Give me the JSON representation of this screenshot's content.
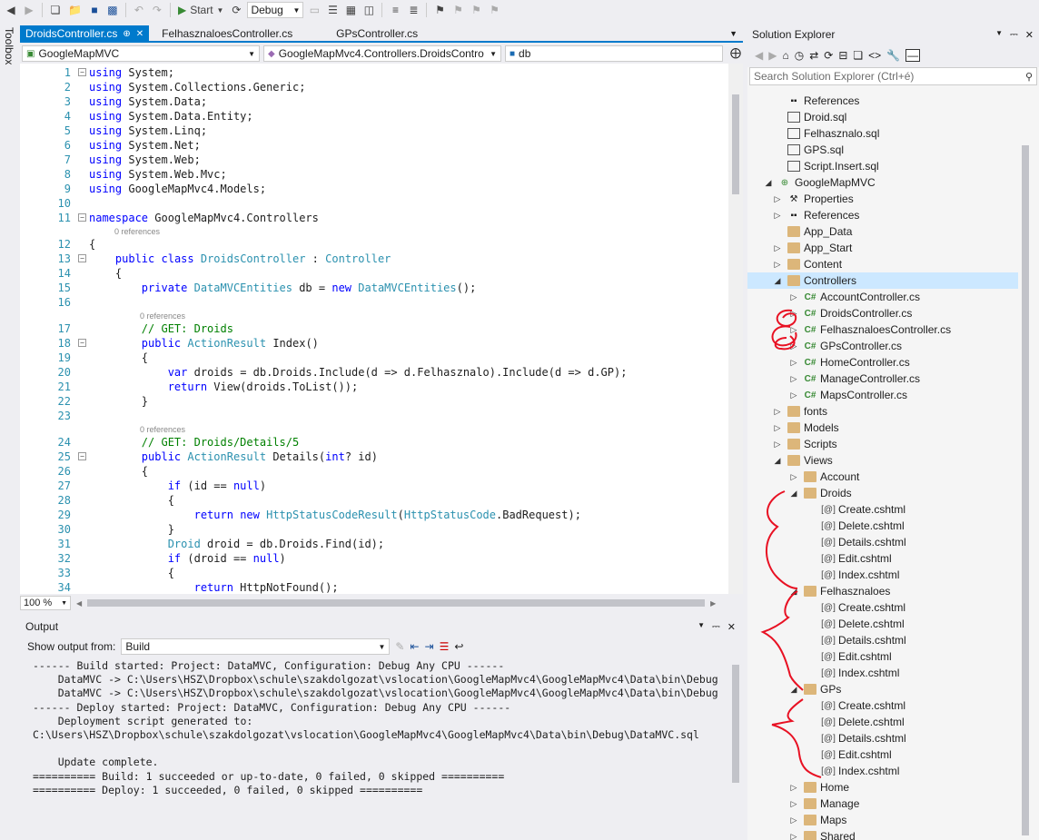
{
  "toolbar": {
    "start_label": "Start",
    "config_value": "Debug"
  },
  "toolbox": {
    "label": "Toolbox"
  },
  "tabs": [
    {
      "label": "DroidsController.cs",
      "pin": "⊕",
      "close": "✕"
    },
    {
      "label": "FelhasznaloesController.cs"
    },
    {
      "label": "GPsController.cs"
    }
  ],
  "navbar": {
    "project": "GoogleMapMVC",
    "class": "GoogleMapMvc4.Controllers.DroidsContro",
    "member": "db"
  },
  "code": {
    "lines": [
      {
        "n": "1",
        "t": "using System;"
      },
      {
        "n": "2",
        "t": "using System.Collections.Generic;"
      },
      {
        "n": "3",
        "t": "using System.Data;"
      },
      {
        "n": "4",
        "t": "using System.Data.Entity;"
      },
      {
        "n": "5",
        "t": "using System.Linq;"
      },
      {
        "n": "6",
        "t": "using System.Net;"
      },
      {
        "n": "7",
        "t": "using System.Web;"
      },
      {
        "n": "8",
        "t": "using System.Web.Mvc;"
      },
      {
        "n": "9",
        "t": "using GoogleMapMvc4.Models;"
      },
      {
        "n": "10",
        "t": ""
      },
      {
        "n": "11",
        "t": "namespace GoogleMapMvc4.Controllers"
      },
      {
        "n": "12",
        "t": "{"
      },
      {
        "n": "13",
        "t": "    public class DroidsController : Controller"
      },
      {
        "n": "14",
        "t": "    {"
      },
      {
        "n": "15",
        "t": "        private DataMVCEntities db = new DataMVCEntities();"
      },
      {
        "n": "16",
        "t": ""
      },
      {
        "n": "17",
        "t": "        // GET: Droids"
      },
      {
        "n": "18",
        "t": "        public ActionResult Index()"
      },
      {
        "n": "19",
        "t": "        {"
      },
      {
        "n": "20",
        "t": "            var droids = db.Droids.Include(d => d.Felhasznalo).Include(d => d.GP);"
      },
      {
        "n": "21",
        "t": "            return View(droids.ToList());"
      },
      {
        "n": "22",
        "t": "        }"
      },
      {
        "n": "23",
        "t": ""
      },
      {
        "n": "24",
        "t": "        // GET: Droids/Details/5"
      },
      {
        "n": "25",
        "t": "        public ActionResult Details(int? id)"
      },
      {
        "n": "26",
        "t": "        {"
      },
      {
        "n": "27",
        "t": "            if (id == null)"
      },
      {
        "n": "28",
        "t": "            {"
      },
      {
        "n": "29",
        "t": "                return new HttpStatusCodeResult(HttpStatusCode.BadRequest);"
      },
      {
        "n": "30",
        "t": "            }"
      },
      {
        "n": "31",
        "t": "            Droid droid = db.Droids.Find(id);"
      },
      {
        "n": "32",
        "t": "            if (droid == null)"
      },
      {
        "n": "33",
        "t": "            {"
      },
      {
        "n": "34",
        "t": "                return HttpNotFound();"
      }
    ],
    "refs_label": "0 references"
  },
  "zoom": "100 %",
  "output": {
    "title": "Output",
    "show_from_label": "Show output from:",
    "source": "Build",
    "lines": [
      "------ Build started: Project: DataMVC, Configuration: Debug Any CPU ------",
      "    DataMVC -> C:\\Users\\HSZ\\Dropbox\\schule\\szakdolgozat\\vslocation\\GoogleMapMvc4\\GoogleMapMvc4\\Data\\bin\\Debug",
      "    DataMVC -> C:\\Users\\HSZ\\Dropbox\\schule\\szakdolgozat\\vslocation\\GoogleMapMvc4\\GoogleMapMvc4\\Data\\bin\\Debug",
      "------ Deploy started: Project: DataMVC, Configuration: Debug Any CPU ------",
      "    Deployment script generated to:",
      "C:\\Users\\HSZ\\Dropbox\\schule\\szakdolgozat\\vslocation\\GoogleMapMvc4\\GoogleMapMvc4\\Data\\bin\\Debug\\DataMVC.sql",
      "",
      "    Update complete.",
      "========== Build: 1 succeeded or up-to-date, 0 failed, 0 skipped ==========",
      "========== Deploy: 1 succeeded, 0 failed, 0 skipped =========="
    ]
  },
  "solution_explorer": {
    "title": "Solution Explorer",
    "search_placeholder": "Search Solution Explorer (Ctrl+é)",
    "items": [
      {
        "label": "References",
        "level": 2,
        "icon": "references-icon",
        "arrow": ""
      },
      {
        "label": "Droid.sql",
        "level": 2,
        "icon": "sql-file-icon",
        "arrow": ""
      },
      {
        "label": "Felhasznalo.sql",
        "level": 2,
        "icon": "sql-file-icon",
        "arrow": ""
      },
      {
        "label": "GPS.sql",
        "level": 2,
        "icon": "sql-file-icon",
        "arrow": ""
      },
      {
        "label": "Script.Insert.sql",
        "level": 2,
        "icon": "sql-file-icon",
        "arrow": ""
      },
      {
        "label": "GoogleMapMVC",
        "level": 1,
        "icon": "web-project-icon",
        "arrow": "open"
      },
      {
        "label": "Properties",
        "level": 2,
        "icon": "wrench-icon",
        "arrow": "closed"
      },
      {
        "label": "References",
        "level": 2,
        "icon": "references-icon",
        "arrow": "closed"
      },
      {
        "label": "App_Data",
        "level": 2,
        "icon": "folder-icon",
        "arrow": ""
      },
      {
        "label": "App_Start",
        "level": 2,
        "icon": "folder-icon",
        "arrow": "closed"
      },
      {
        "label": "Content",
        "level": 2,
        "icon": "folder-icon",
        "arrow": "closed"
      },
      {
        "label": "Controllers",
        "level": 2,
        "icon": "folder-open-icon",
        "arrow": "open",
        "selected": true
      },
      {
        "label": "AccountController.cs",
        "level": 3,
        "icon": "csharp-file-icon",
        "arrow": "closed"
      },
      {
        "label": "DroidsController.cs",
        "level": 3,
        "icon": "csharp-file-icon",
        "arrow": "closed"
      },
      {
        "label": "FelhasznaloesController.cs",
        "level": 3,
        "icon": "csharp-file-icon",
        "arrow": "closed"
      },
      {
        "label": "GPsController.cs",
        "level": 3,
        "icon": "csharp-file-icon",
        "arrow": "closed"
      },
      {
        "label": "HomeController.cs",
        "level": 3,
        "icon": "csharp-file-icon",
        "arrow": "closed"
      },
      {
        "label": "ManageController.cs",
        "level": 3,
        "icon": "csharp-file-icon",
        "arrow": "closed"
      },
      {
        "label": "MapsController.cs",
        "level": 3,
        "icon": "csharp-file-icon",
        "arrow": "closed"
      },
      {
        "label": "fonts",
        "level": 2,
        "icon": "folder-icon",
        "arrow": "closed"
      },
      {
        "label": "Models",
        "level": 2,
        "icon": "folder-icon",
        "arrow": "closed"
      },
      {
        "label": "Scripts",
        "level": 2,
        "icon": "folder-icon",
        "arrow": "closed"
      },
      {
        "label": "Views",
        "level": 2,
        "icon": "folder-open-icon",
        "arrow": "open"
      },
      {
        "label": "Account",
        "level": 3,
        "icon": "folder-icon",
        "arrow": "closed"
      },
      {
        "label": "Droids",
        "level": 3,
        "icon": "folder-open-icon",
        "arrow": "open"
      },
      {
        "label": "Create.cshtml",
        "level": 4,
        "icon": "cshtml-file-icon",
        "arrow": ""
      },
      {
        "label": "Delete.cshtml",
        "level": 4,
        "icon": "cshtml-file-icon",
        "arrow": ""
      },
      {
        "label": "Details.cshtml",
        "level": 4,
        "icon": "cshtml-file-icon",
        "arrow": ""
      },
      {
        "label": "Edit.cshtml",
        "level": 4,
        "icon": "cshtml-file-icon",
        "arrow": ""
      },
      {
        "label": "Index.cshtml",
        "level": 4,
        "icon": "cshtml-file-icon",
        "arrow": ""
      },
      {
        "label": "Felhasznaloes",
        "level": 3,
        "icon": "folder-open-icon",
        "arrow": "open"
      },
      {
        "label": "Create.cshtml",
        "level": 4,
        "icon": "cshtml-file-icon",
        "arrow": ""
      },
      {
        "label": "Delete.cshtml",
        "level": 4,
        "icon": "cshtml-file-icon",
        "arrow": ""
      },
      {
        "label": "Details.cshtml",
        "level": 4,
        "icon": "cshtml-file-icon",
        "arrow": ""
      },
      {
        "label": "Edit.cshtml",
        "level": 4,
        "icon": "cshtml-file-icon",
        "arrow": ""
      },
      {
        "label": "Index.cshtml",
        "level": 4,
        "icon": "cshtml-file-icon",
        "arrow": ""
      },
      {
        "label": "GPs",
        "level": 3,
        "icon": "folder-open-icon",
        "arrow": "open"
      },
      {
        "label": "Create.cshtml",
        "level": 4,
        "icon": "cshtml-file-icon",
        "arrow": ""
      },
      {
        "label": "Delete.cshtml",
        "level": 4,
        "icon": "cshtml-file-icon",
        "arrow": ""
      },
      {
        "label": "Details.cshtml",
        "level": 4,
        "icon": "cshtml-file-icon",
        "arrow": ""
      },
      {
        "label": "Edit.cshtml",
        "level": 4,
        "icon": "cshtml-file-icon",
        "arrow": ""
      },
      {
        "label": "Index.cshtml",
        "level": 4,
        "icon": "cshtml-file-icon",
        "arrow": ""
      },
      {
        "label": "Home",
        "level": 3,
        "icon": "folder-icon",
        "arrow": "closed"
      },
      {
        "label": "Manage",
        "level": 3,
        "icon": "folder-icon",
        "arrow": "closed"
      },
      {
        "label": "Maps",
        "level": 3,
        "icon": "folder-icon",
        "arrow": "closed"
      },
      {
        "label": "Shared",
        "level": 3,
        "icon": "folder-icon",
        "arrow": "closed"
      }
    ]
  },
  "colors": {
    "accent": "#007acc",
    "annotation": "#e81123",
    "selection": "#cce8ff"
  }
}
